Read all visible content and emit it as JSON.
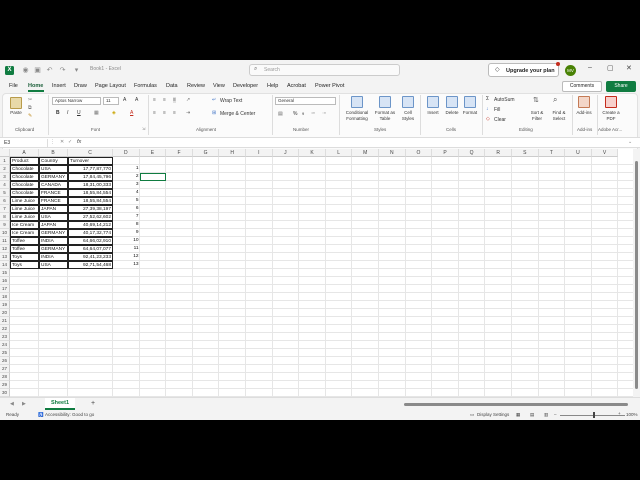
{
  "titlebar": {
    "logo_letter": "X",
    "doc_title": "Book1 - Excel",
    "search_placeholder": "Search",
    "upgrade_label": "Upgrade your plan",
    "avatar_initials": "MV"
  },
  "tabs": [
    "File",
    "Home",
    "Insert",
    "Draw",
    "Page Layout",
    "Formulas",
    "Data",
    "Review",
    "View",
    "Developer",
    "Help",
    "Acrobat",
    "Power Pivot"
  ],
  "active_tab": "Home",
  "actions": {
    "comments": "Comments",
    "share": "Share"
  },
  "ribbon": {
    "clipboard": {
      "label": "Clipboard",
      "paste": "Paste"
    },
    "font": {
      "label": "Font",
      "name": "Aptos Narrow",
      "size": "11"
    },
    "alignment": {
      "label": "Alignment",
      "wrap": "Wrap Text",
      "merge": "Merge & Center"
    },
    "number": {
      "label": "Number",
      "format": "General"
    },
    "styles": {
      "label": "Styles",
      "conditional": "Conditional Formatting",
      "format_table": "Format as Table",
      "cell_styles": "Cell Styles"
    },
    "cells": {
      "label": "Cells",
      "insert": "Insert",
      "delete": "Delete",
      "format": "Format"
    },
    "editing": {
      "label": "Editing",
      "autosum": "AutoSum",
      "fill": "Fill",
      "clear": "Clear",
      "sort": "Sort & Filter",
      "find": "Find & Select"
    },
    "addins": {
      "label": "Add-ins",
      "button": "Add-ins"
    },
    "acrobat": {
      "label": "Adobe Acr...",
      "button": "Create a PDF"
    }
  },
  "formula_bar": {
    "name_box": "E3",
    "fx": "fx",
    "content": ""
  },
  "columns": [
    "A",
    "B",
    "C",
    "D",
    "E",
    "F",
    "G",
    "H",
    "I",
    "J",
    "K",
    "L",
    "M",
    "N",
    "O",
    "P",
    "Q",
    "R",
    "S",
    "T",
    "U",
    "V"
  ],
  "table": {
    "headers": [
      "Product",
      "Country",
      "Turnover"
    ],
    "rows": [
      [
        "Chocolate",
        "USA",
        "17,77,87,770",
        "1"
      ],
      [
        "Chocolate",
        "GERMANY",
        "17,84,45,796",
        "2"
      ],
      [
        "Chocolate",
        "CANADA",
        "18,31,00,333",
        "3"
      ],
      [
        "Chocolate",
        "FRANCE",
        "18,55,84,554",
        "4"
      ],
      [
        "Lime Juice",
        "FRANCE",
        "18,55,84,554",
        "5"
      ],
      [
        "Lime Juice",
        "JAPAN",
        "27,39,38,197",
        "6"
      ],
      [
        "Lime Juice",
        "USA",
        "27,52,62,602",
        "7"
      ],
      [
        "Ice Cream",
        "JAPAN",
        "40,69,14,212",
        "8"
      ],
      [
        "Ice Cream",
        "GERMANY",
        "40,17,32,774",
        "9"
      ],
      [
        "Toffee",
        "INDIA",
        "64,66,02,910",
        "10"
      ],
      [
        "Toffee",
        "GERMANY",
        "64,64,07,077",
        "11"
      ],
      [
        "Toys",
        "INDIA",
        "92,41,23,233",
        "12"
      ],
      [
        "Toys",
        "USA",
        "92,71,54,468",
        "13"
      ]
    ]
  },
  "sheets": {
    "active": "Sheet1"
  },
  "status": {
    "ready": "Ready",
    "accessibility": "Accessibility: Good to go",
    "display": "Display Settings",
    "zoom": "100%"
  }
}
